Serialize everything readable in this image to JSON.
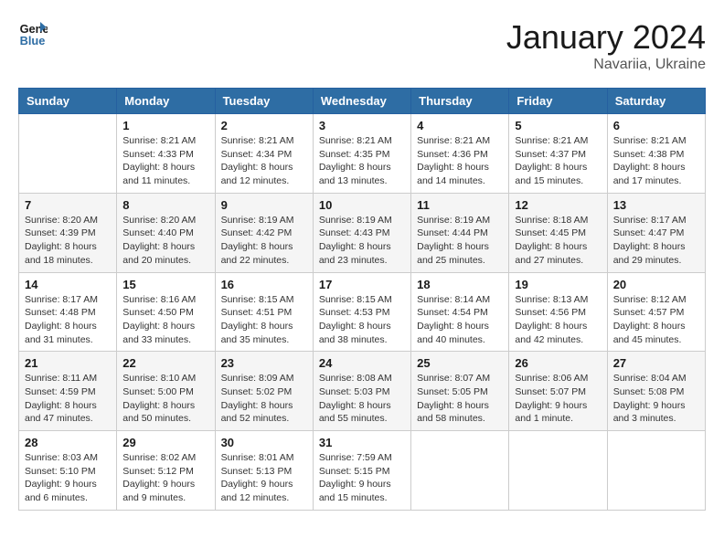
{
  "logo": {
    "line1": "General",
    "line2": "Blue"
  },
  "title": "January 2024",
  "location": "Navariia, Ukraine",
  "days_header": [
    "Sunday",
    "Monday",
    "Tuesday",
    "Wednesday",
    "Thursday",
    "Friday",
    "Saturday"
  ],
  "weeks": [
    [
      {
        "day": "",
        "info": ""
      },
      {
        "day": "1",
        "info": "Sunrise: 8:21 AM\nSunset: 4:33 PM\nDaylight: 8 hours\nand 11 minutes."
      },
      {
        "day": "2",
        "info": "Sunrise: 8:21 AM\nSunset: 4:34 PM\nDaylight: 8 hours\nand 12 minutes."
      },
      {
        "day": "3",
        "info": "Sunrise: 8:21 AM\nSunset: 4:35 PM\nDaylight: 8 hours\nand 13 minutes."
      },
      {
        "day": "4",
        "info": "Sunrise: 8:21 AM\nSunset: 4:36 PM\nDaylight: 8 hours\nand 14 minutes."
      },
      {
        "day": "5",
        "info": "Sunrise: 8:21 AM\nSunset: 4:37 PM\nDaylight: 8 hours\nand 15 minutes."
      },
      {
        "day": "6",
        "info": "Sunrise: 8:21 AM\nSunset: 4:38 PM\nDaylight: 8 hours\nand 17 minutes."
      }
    ],
    [
      {
        "day": "7",
        "info": ""
      },
      {
        "day": "8",
        "info": "Sunrise: 8:20 AM\nSunset: 4:40 PM\nDaylight: 8 hours\nand 20 minutes."
      },
      {
        "day": "9",
        "info": "Sunrise: 8:19 AM\nSunset: 4:42 PM\nDaylight: 8 hours\nand 22 minutes."
      },
      {
        "day": "10",
        "info": "Sunrise: 8:19 AM\nSunset: 4:43 PM\nDaylight: 8 hours\nand 23 minutes."
      },
      {
        "day": "11",
        "info": "Sunrise: 8:19 AM\nSunset: 4:44 PM\nDaylight: 8 hours\nand 25 minutes."
      },
      {
        "day": "12",
        "info": "Sunrise: 8:18 AM\nSunset: 4:45 PM\nDaylight: 8 hours\nand 27 minutes."
      },
      {
        "day": "13",
        "info": "Sunrise: 8:17 AM\nSunset: 4:47 PM\nDaylight: 8 hours\nand 29 minutes."
      }
    ],
    [
      {
        "day": "14",
        "info": ""
      },
      {
        "day": "15",
        "info": "Sunrise: 8:16 AM\nSunset: 4:50 PM\nDaylight: 8 hours\nand 33 minutes."
      },
      {
        "day": "16",
        "info": "Sunrise: 8:15 AM\nSunset: 4:51 PM\nDaylight: 8 hours\nand 35 minutes."
      },
      {
        "day": "17",
        "info": "Sunrise: 8:15 AM\nSunset: 4:53 PM\nDaylight: 8 hours\nand 38 minutes."
      },
      {
        "day": "18",
        "info": "Sunrise: 8:14 AM\nSunset: 4:54 PM\nDaylight: 8 hours\nand 40 minutes."
      },
      {
        "day": "19",
        "info": "Sunrise: 8:13 AM\nSunset: 4:56 PM\nDaylight: 8 hours\nand 42 minutes."
      },
      {
        "day": "20",
        "info": "Sunrise: 8:12 AM\nSunset: 4:57 PM\nDaylight: 8 hours\nand 45 minutes."
      }
    ],
    [
      {
        "day": "21",
        "info": ""
      },
      {
        "day": "22",
        "info": "Sunrise: 8:10 AM\nSunset: 5:00 PM\nDaylight: 8 hours\nand 50 minutes."
      },
      {
        "day": "23",
        "info": "Sunrise: 8:09 AM\nSunset: 5:02 PM\nDaylight: 8 hours\nand 52 minutes."
      },
      {
        "day": "24",
        "info": "Sunrise: 8:08 AM\nSunset: 5:03 PM\nDaylight: 8 hours\nand 55 minutes."
      },
      {
        "day": "25",
        "info": "Sunrise: 8:07 AM\nSunset: 5:05 PM\nDaylight: 8 hours\nand 58 minutes."
      },
      {
        "day": "26",
        "info": "Sunrise: 8:06 AM\nSunset: 5:07 PM\nDaylight: 9 hours\nand 1 minute."
      },
      {
        "day": "27",
        "info": "Sunrise: 8:04 AM\nSunset: 5:08 PM\nDaylight: 9 hours\nand 3 minutes."
      }
    ],
    [
      {
        "day": "28",
        "info": ""
      },
      {
        "day": "29",
        "info": "Sunrise: 8:02 AM\nSunset: 5:12 PM\nDaylight: 9 hours\nand 9 minutes."
      },
      {
        "day": "30",
        "info": "Sunrise: 8:01 AM\nSunset: 5:13 PM\nDaylight: 9 hours\nand 12 minutes."
      },
      {
        "day": "31",
        "info": "Sunrise: 7:59 AM\nSunset: 5:15 PM\nDaylight: 9 hours\nand 15 minutes."
      },
      {
        "day": "",
        "info": ""
      },
      {
        "day": "",
        "info": ""
      },
      {
        "day": "",
        "info": ""
      }
    ]
  ],
  "week_sunday_infos": [
    "",
    "Sunrise: 8:20 AM\nSunset: 4:39 PM\nDaylight: 8 hours\nand 18 minutes.",
    "Sunrise: 8:17 AM\nSunset: 4:48 PM\nDaylight: 8 hours\nand 31 minutes.",
    "Sunrise: 8:11 AM\nSunset: 4:59 PM\nDaylight: 8 hours\nand 47 minutes.",
    "Sunrise: 8:03 AM\nSunset: 5:10 PM\nDaylight: 9 hours\nand 6 minutes."
  ]
}
